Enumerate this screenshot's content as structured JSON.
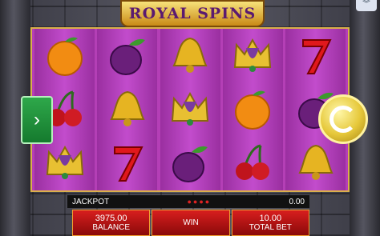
{
  "game": {
    "title": "ROYAL SPINS"
  },
  "reels": [
    [
      "orange-icon",
      "cherries-icon",
      "crown-icon"
    ],
    [
      "plum-icon",
      "bell-icon",
      "seven-icon"
    ],
    [
      "bell-icon",
      "crown-icon",
      "plum-icon"
    ],
    [
      "crown-icon",
      "orange-icon",
      "cherries-icon"
    ],
    [
      "seven-icon",
      "plum-icon",
      "bell-icon"
    ]
  ],
  "jackpot": {
    "label": "JACKPOT",
    "value": "0.00"
  },
  "panel": {
    "balance_value": "3975.00",
    "balance_label": "BALANCE",
    "win_label": "WIN",
    "bet_value": "10.00",
    "bet_label": "TOTAL BET"
  },
  "icons": {
    "nav_left": "chevron-right-icon",
    "spin": "spin-arrow-icon",
    "menu": "double-chevron-down-icon"
  }
}
